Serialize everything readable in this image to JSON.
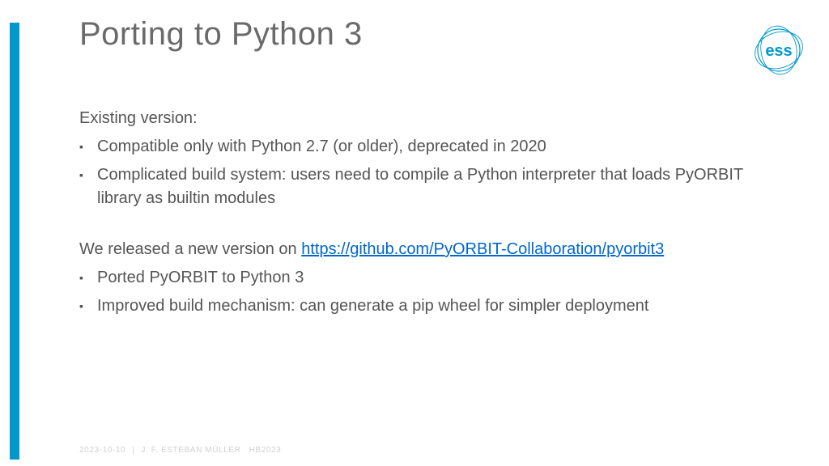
{
  "title": "Porting to Python 3",
  "section1": {
    "label": "Existing version:",
    "items": [
      "Compatible only with Python 2.7 (or older), deprecated in 2020",
      "Complicated build system: users need to compile a Python interpreter that loads PyORBIT library as builtin modules"
    ]
  },
  "section2": {
    "label_prefix": "We released a new version on ",
    "link_text": "https://github.com/PyORBIT-Collaboration/pyorbit3",
    "items": [
      "Ported PyORBIT to Python 3",
      "Improved build mechanism: can generate a pip wheel for simpler deployment"
    ]
  },
  "footer": {
    "date": "2023-10-10",
    "author": "J. F. ESTEBAN MÜLLER",
    "event": "HB2023"
  },
  "logo": {
    "text": "ess"
  }
}
